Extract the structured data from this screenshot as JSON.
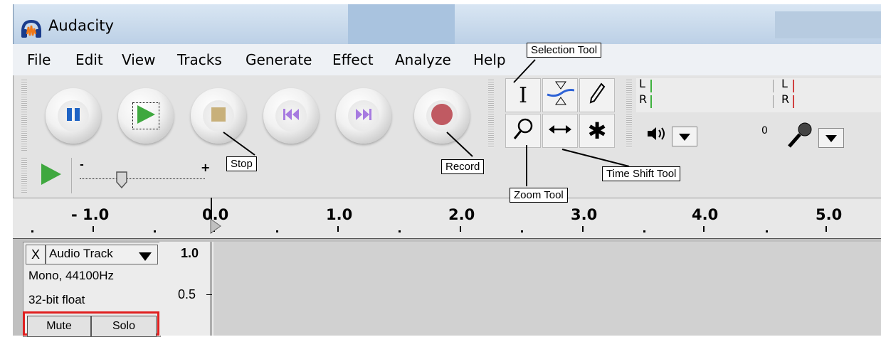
{
  "window": {
    "title": "Audacity"
  },
  "menu": [
    "File",
    "Edit",
    "View",
    "Tracks",
    "Generate",
    "Effect",
    "Analyze",
    "Help"
  ],
  "transport": {
    "buttons": [
      "pause-icon",
      "play-icon",
      "stop-icon",
      "skip-start-icon",
      "skip-end-icon",
      "record-icon"
    ],
    "colors": {
      "play": "#3fa83f",
      "pause": "#1e63c4",
      "stop": "#c8b07a",
      "skip": "#a77be0",
      "record": "#c05a62"
    }
  },
  "tools": [
    "selection-tool-icon",
    "envelope-tool-icon",
    "draw-tool-icon",
    "zoom-tool-icon",
    "time-shift-tool-icon",
    "multi-tool-icon"
  ],
  "meters": {
    "left_label": "L",
    "right_label": "R",
    "zero_label": "0"
  },
  "speed": {
    "minus": "-",
    "plus": "+"
  },
  "callouts": {
    "selection": "Selection Tool",
    "stop": "Stop",
    "record": "Record",
    "time_shift": "Time Shift Tool",
    "zoom": "Zoom Tool"
  },
  "ruler": [
    "- 1.0",
    "0.0",
    "1.0",
    "2.0",
    "3.0",
    "4.0",
    "5.0"
  ],
  "track": {
    "name": "Audio Track",
    "close": "X",
    "format": "Mono, 44100Hz",
    "bitdepth": "32-bit float",
    "mute": "Mute",
    "solo": "Solo",
    "scale_top": "1.0",
    "scale_mid": "0.5"
  }
}
